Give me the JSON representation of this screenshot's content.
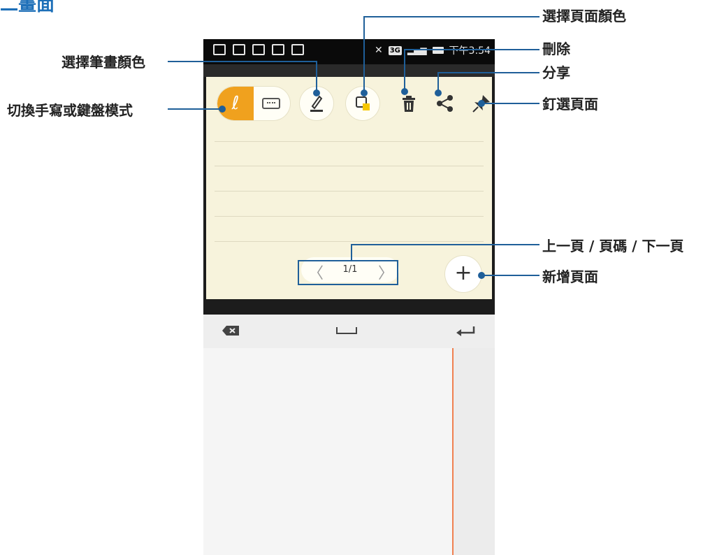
{
  "header": {
    "title": "二畫面"
  },
  "phone": {
    "status_time": "下午3:54",
    "network_badge": "3G"
  },
  "note": {
    "pager": {
      "prev": "〈",
      "page": "1/1",
      "next": "〉"
    },
    "add_label": "+"
  },
  "callouts": {
    "page_color": "選擇頁面顏色",
    "delete": "刪除",
    "share": "分享",
    "pin": "釘選頁面",
    "pen_color": "選擇筆畫顏色",
    "mode_toggle": "切換手寫或鍵盤模式",
    "pagination": "上一頁 / 頁碼 / 下一頁",
    "add_page": "新增頁面"
  },
  "icons": {
    "handwriting": "handwriting-icon",
    "keyboard": "keyboard-icon",
    "pen": "pen-color-icon",
    "page_color": "page-color-icon",
    "trash": "trash-icon",
    "share": "share-icon",
    "pin": "pin-icon",
    "backspace": "backspace-icon",
    "space": "space-icon",
    "enter": "enter-icon"
  },
  "colors": {
    "accent": "#f0a11e",
    "callout_line": "#1f5f99",
    "note_bg": "#f7f3dc"
  }
}
